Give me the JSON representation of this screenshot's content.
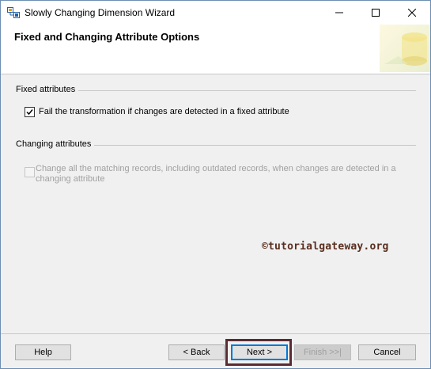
{
  "window": {
    "title": "Slowly Changing Dimension Wizard"
  },
  "header": {
    "title": "Fixed and Changing Attribute Options"
  },
  "fixed_attributes": {
    "group_label": "Fixed attributes",
    "checkbox_label": "Fail the transformation if changes are detected in a fixed attribute",
    "checked": true
  },
  "changing_attributes": {
    "group_label": "Changing attributes",
    "checkbox_label_line1": "Change all the matching records, including outdated records, when changes are detected in a",
    "checkbox_label_line2": "changing attribute",
    "checked": false,
    "enabled": false
  },
  "watermark": "©tutorialgateway.org",
  "buttons": {
    "help": "Help",
    "back": "< Back",
    "next": "Next >",
    "finish": "Finish >>|",
    "cancel": "Cancel"
  },
  "colors": {
    "highlight_box": "#5a2c33",
    "watermark": "#5a2e1e",
    "focus": "#0078d7"
  }
}
